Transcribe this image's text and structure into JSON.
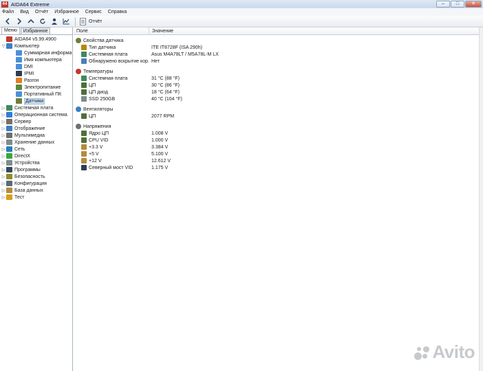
{
  "window": {
    "title": "AIDA64 Extreme",
    "icon_text": "64",
    "buttons": [
      "–",
      "□",
      "✕"
    ]
  },
  "menubar": [
    "Файл",
    "Вид",
    "Отчёт",
    "Избранное",
    "Сервис",
    "Справка"
  ],
  "toolbar": {
    "report_label": "Отчёт",
    "icons": [
      "back-icon",
      "forward-icon",
      "up-icon",
      "refresh-icon",
      "user-icon",
      "chart-icon",
      "report-icon"
    ]
  },
  "sidebar": {
    "tabs": [
      "Меню",
      "Избранное"
    ],
    "tree": [
      {
        "label": "AIDA64 v5.99.4900",
        "icon": "aida64-icon",
        "color": "#c0392b",
        "indent": 0,
        "expander": ""
      },
      {
        "label": "Компьютер",
        "icon": "computer-icon",
        "color": "#3b7fc4",
        "indent": 0,
        "expander": "▽"
      },
      {
        "label": "Суммарная информа",
        "icon": "summary-icon",
        "color": "#4a90d9",
        "indent": 1,
        "expander": ""
      },
      {
        "label": "Имя компьютера",
        "icon": "computer-name-icon",
        "color": "#4a90d9",
        "indent": 1,
        "expander": ""
      },
      {
        "label": "DMI",
        "icon": "dmi-icon",
        "color": "#4a90d9",
        "indent": 1,
        "expander": ""
      },
      {
        "label": "IPMI",
        "icon": "ipmi-icon",
        "color": "#2c3e50",
        "indent": 1,
        "expander": ""
      },
      {
        "label": "Разгон",
        "icon": "overclock-icon",
        "color": "#e67e22",
        "indent": 1,
        "expander": ""
      },
      {
        "label": "Электропитание",
        "icon": "power-icon",
        "color": "#5d8a3a",
        "indent": 1,
        "expander": ""
      },
      {
        "label": "Портативный ПК",
        "icon": "laptop-icon",
        "color": "#4a90d9",
        "indent": 1,
        "expander": ""
      },
      {
        "label": "Датчики",
        "icon": "sensor-icon",
        "color": "#6d7e3a",
        "indent": 1,
        "expander": "",
        "selected": true
      },
      {
        "label": "Системная плата",
        "icon": "motherboard-icon",
        "color": "#3f8a5a",
        "indent": 0,
        "expander": "▷"
      },
      {
        "label": "Операционная система",
        "icon": "os-icon",
        "color": "#2f7fd6",
        "indent": 0,
        "expander": "▷"
      },
      {
        "label": "Сервер",
        "icon": "server-icon",
        "color": "#7a6f64",
        "indent": 0,
        "expander": "▷"
      },
      {
        "label": "Отображение",
        "icon": "display-icon",
        "color": "#3b7fc4",
        "indent": 0,
        "expander": "▷"
      },
      {
        "label": "Мультимедиа",
        "icon": "multimedia-icon",
        "color": "#6f6f6f",
        "indent": 0,
        "expander": "▷"
      },
      {
        "label": "Хранение данных",
        "icon": "storage-icon",
        "color": "#7f8c8d",
        "indent": 0,
        "expander": "▷"
      },
      {
        "label": "Сеть",
        "icon": "network-icon",
        "color": "#2c7fb8",
        "indent": 0,
        "expander": "▷"
      },
      {
        "label": "DirectX",
        "icon": "directx-icon",
        "color": "#3aa63a",
        "indent": 0,
        "expander": "▷"
      },
      {
        "label": "Устройства",
        "icon": "devices-icon",
        "color": "#7f8c8d",
        "indent": 0,
        "expander": "▷"
      },
      {
        "label": "Программы",
        "icon": "programs-icon",
        "color": "#34495e",
        "indent": 0,
        "expander": "▷"
      },
      {
        "label": "Безопасность",
        "icon": "security-icon",
        "color": "#8e8e2a",
        "indent": 0,
        "expander": "▷"
      },
      {
        "label": "Конфигурация",
        "icon": "config-icon",
        "color": "#5b6a7a",
        "indent": 0,
        "expander": "▷"
      },
      {
        "label": "База данных",
        "icon": "database-icon",
        "color": "#b38b3e",
        "indent": 0,
        "expander": "▷"
      },
      {
        "label": "Тест",
        "icon": "test-icon",
        "color": "#d4a017",
        "indent": 0,
        "expander": "▷"
      }
    ]
  },
  "main": {
    "columns": [
      "Поле",
      "Значение"
    ],
    "groups": [
      {
        "label": "Свойства датчика",
        "icon": "sensor-props-icon",
        "color": "#6d7e3a",
        "items": [
          {
            "field": "Тип датчика",
            "value": "ITE IT8728F  (ISA 290h)",
            "icon": "sensor-type-icon",
            "color": "#b8860b"
          },
          {
            "field": "Системная плата",
            "value": "Asus M4A78LT / M5A78L-M LX",
            "icon": "motherboard-icon",
            "color": "#3f8a5a"
          },
          {
            "field": "Обнаружено вскрытие кор...",
            "value": "Нет",
            "icon": "shield-icon",
            "color": "#4a7fb8"
          }
        ]
      },
      {
        "label": "Температуры",
        "icon": "thermometer-icon",
        "color": "#c0392b",
        "items": [
          {
            "field": "Системная плата",
            "value": "31 °C  (88 °F)",
            "icon": "motherboard-icon",
            "color": "#3f8a5a"
          },
          {
            "field": "ЦП",
            "value": "30 °C  (86 °F)",
            "icon": "cpu-icon",
            "color": "#4f6f3a"
          },
          {
            "field": "ЦП диод",
            "value": "18 °C  (64 °F)",
            "icon": "cpu-icon",
            "color": "#4f6f3a"
          },
          {
            "field": "SSD 250GB",
            "value": "40 °C  (104 °F)",
            "icon": "disk-icon",
            "color": "#7f8c8d"
          }
        ]
      },
      {
        "label": "Вентиляторы",
        "icon": "fan-icon",
        "color": "#3b7fc4",
        "items": [
          {
            "field": "ЦП",
            "value": "2077 RPM",
            "icon": "cpu-icon",
            "color": "#4f6f3a"
          }
        ]
      },
      {
        "label": "Напряжения",
        "icon": "voltage-icon",
        "color": "#6f6f6f",
        "items": [
          {
            "field": "Ядро ЦП",
            "value": "1.008 V",
            "icon": "cpu-icon",
            "color": "#4f6f3a"
          },
          {
            "field": "CPU VID",
            "value": "1.000 V",
            "icon": "cpu-icon",
            "color": "#4f6f3a"
          },
          {
            "field": "+3.3 V",
            "value": "3.384 V",
            "icon": "voltage-icon",
            "color": "#b38b3e"
          },
          {
            "field": "+5 V",
            "value": "5.100 V",
            "icon": "voltage-icon",
            "color": "#b38b3e"
          },
          {
            "field": "+12 V",
            "value": "12.612 V",
            "icon": "voltage-icon",
            "color": "#b38b3e"
          },
          {
            "field": "Северный мост VID",
            "value": "1.175 V",
            "icon": "chip-icon",
            "color": "#2c3e50"
          }
        ]
      }
    ]
  },
  "watermark": {
    "text": "Avito"
  }
}
